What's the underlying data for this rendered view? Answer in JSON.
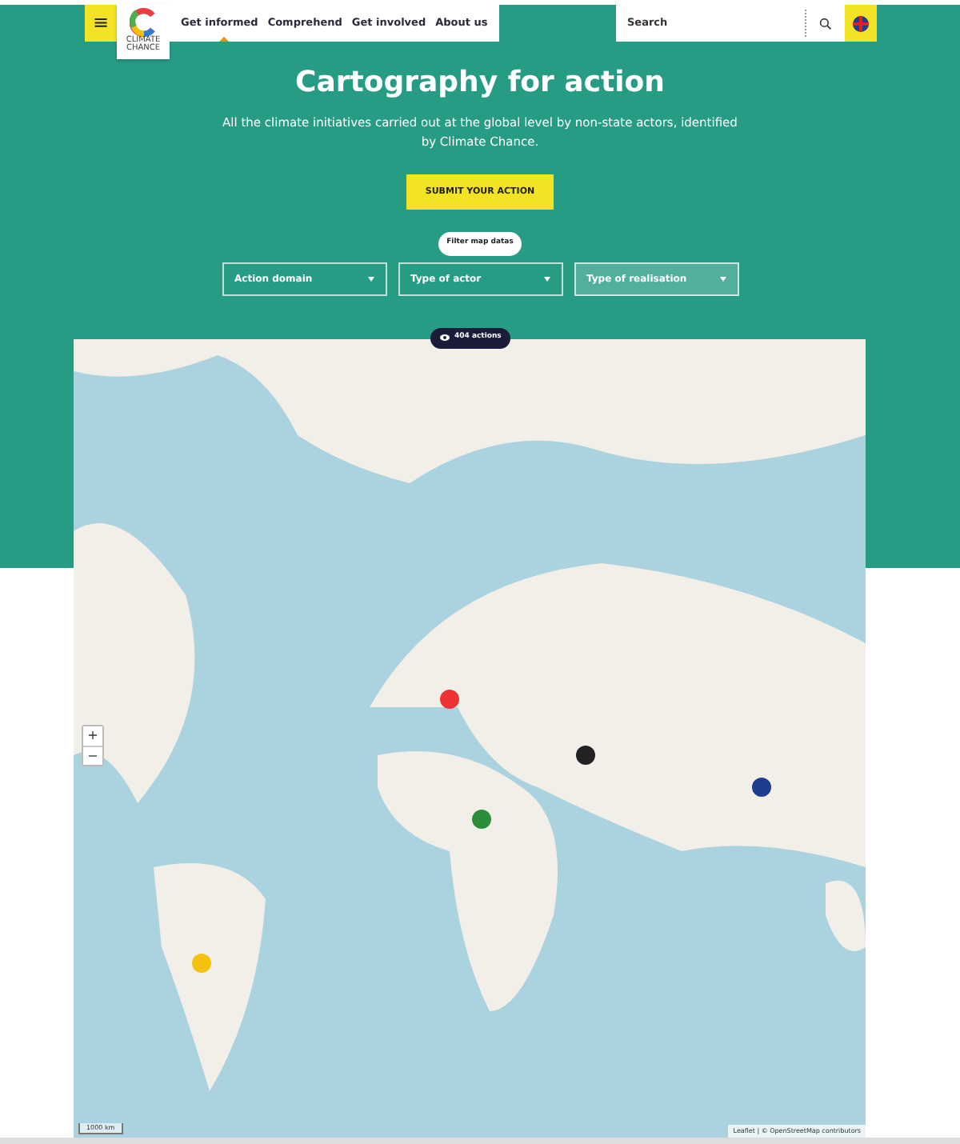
{
  "header": {
    "menu_icon": "≡",
    "logo_text": "CLIMATE CHANCE",
    "nav": [
      {
        "label": "Get informed",
        "selected": true
      },
      {
        "label": "Comprehend",
        "selected": false
      },
      {
        "label": "Get involved",
        "selected": false
      },
      {
        "label": "About us",
        "selected": false
      }
    ],
    "search": {
      "placeholder": "Search"
    }
  },
  "hero": {
    "title": "Cartography for action",
    "subtitle": "All the climate initiatives carried out at the global level by non-state actors, identified by Climate Chance.",
    "button": "SUBMIT YOUR ACTION"
  },
  "filters": {
    "label": "Filter map datas",
    "selects": [
      {
        "label": "Action domain",
        "selected": false
      },
      {
        "label": "Type of actor",
        "selected": false
      },
      {
        "label": "Type of realisation",
        "selected": true
      }
    ]
  },
  "map": {
    "count": "404 actions",
    "zoom_in": "+",
    "zoom_out": "−",
    "scale": "1000 km",
    "attribution_link": "Leaflet",
    "attribution_separator": "|",
    "attribution": "© OpenStreetMap contributors"
  }
}
